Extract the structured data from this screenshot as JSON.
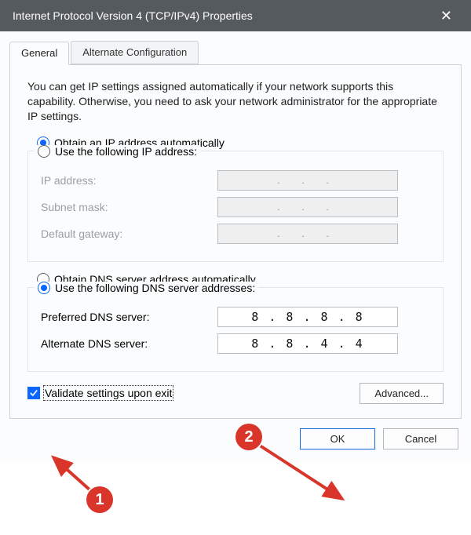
{
  "window": {
    "title": "Internet Protocol Version 4 (TCP/IPv4) Properties"
  },
  "tabs": {
    "general": "General",
    "alt": "Alternate Configuration"
  },
  "intro": "You can get IP settings assigned automatically if your network supports this capability. Otherwise, you need to ask your network administrator for the appropriate IP settings.",
  "ip": {
    "auto_label": "Obtain an IP address automatically",
    "manual_label": "Use the following IP address:",
    "fields": {
      "address": "IP address:",
      "mask": "Subnet mask:",
      "gateway": "Default gateway:"
    },
    "dot_placeholder": ".       .       ."
  },
  "dns": {
    "auto_label": "Obtain DNS server address automatically",
    "manual_label": "Use the following DNS server addresses:",
    "fields": {
      "preferred": "Preferred DNS server:",
      "alternate": "Alternate DNS server:"
    },
    "preferred_value": "8 . 8 . 8 . 8",
    "alternate_value": "8 . 8 . 4 . 4"
  },
  "validate_label": "Validate settings upon exit",
  "advanced_label": "Advanced...",
  "ok_label": "OK",
  "cancel_label": "Cancel",
  "annotations": {
    "one": "1",
    "two": "2"
  }
}
